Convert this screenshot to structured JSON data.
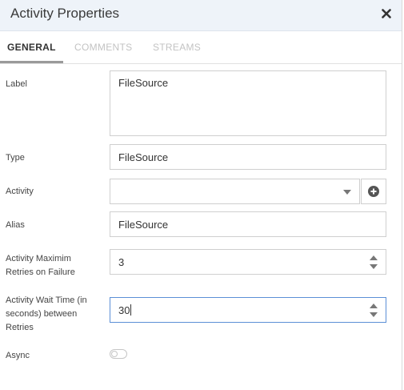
{
  "dialog": {
    "title": "Activity Properties",
    "close_icon": "close-icon"
  },
  "tabs": [
    {
      "label": "GENERAL",
      "active": true
    },
    {
      "label": "COMMENTS",
      "active": false
    },
    {
      "label": "STREAMS",
      "active": false
    }
  ],
  "form": {
    "label": {
      "label": "Label",
      "value": "FileSource"
    },
    "type": {
      "label": "Type",
      "value": "FileSource"
    },
    "activity": {
      "label": "Activity",
      "value": "",
      "add_icon": "plus-circle-icon",
      "dropdown_icon": "chevron-down-icon"
    },
    "alias": {
      "label": "Alias",
      "value": "FileSource"
    },
    "retries": {
      "label_line1": "Activity Maximim",
      "label_line2": "Retries on Failure",
      "value": "3"
    },
    "wait_time": {
      "label_line1": "Activity Wait Time (in",
      "label_line2": "seconds) between",
      "label_line3": "Retries",
      "value": "30"
    },
    "async": {
      "label": "Async",
      "enabled": false
    }
  },
  "colors": {
    "header_bg": "#eef3f9",
    "focus_border": "#5b8fd6",
    "inactive_tab": "#c3c3c3"
  }
}
